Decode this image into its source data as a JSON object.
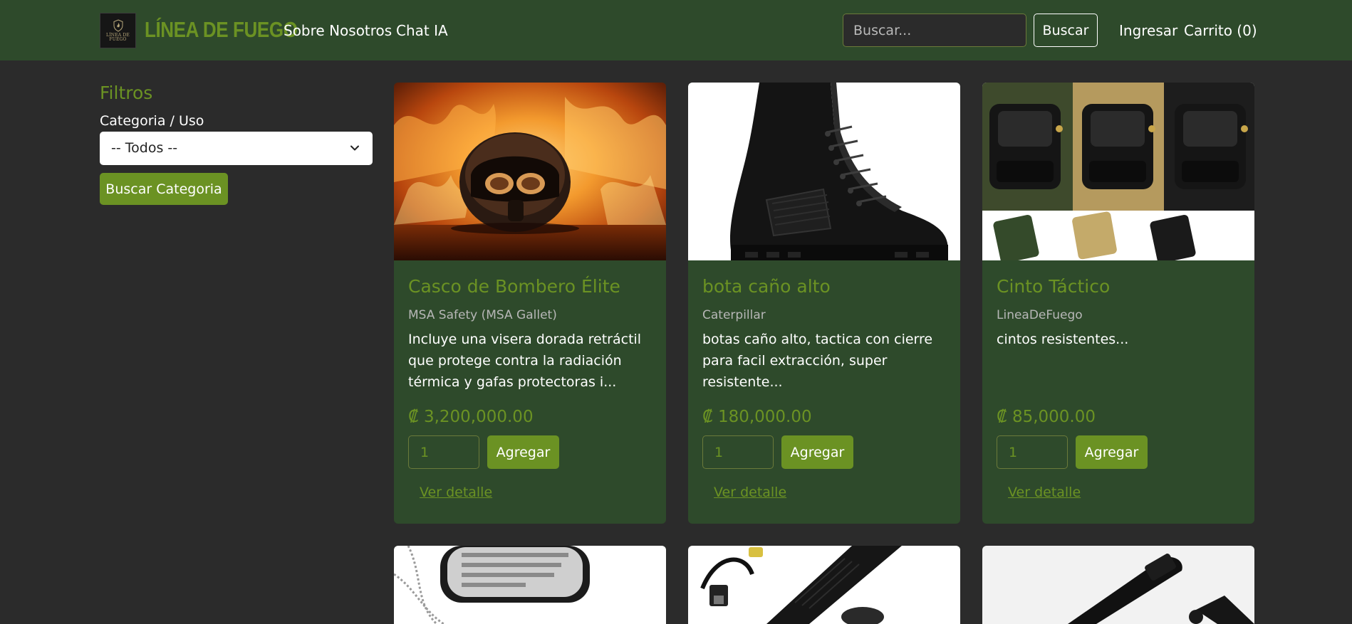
{
  "navbar": {
    "logo_text_line1": "LÍNEA DE",
    "logo_text_line2": "FUEGO",
    "brand": "LÍNEA DE FUEGO",
    "links": [
      {
        "label": "Sobre Nosotros"
      },
      {
        "label": "Chat IA"
      }
    ],
    "search_placeholder": "Buscar...",
    "search_button": "Buscar",
    "login": "Ingresar",
    "cart": "Carrito (0)"
  },
  "sidebar": {
    "title": "Filtros",
    "category_label": "Categoria / Uso",
    "category_selected": "-- Todos --",
    "category_button": "Buscar Categoria"
  },
  "products": [
    {
      "name": "Casco de Bombero Élite",
      "brand": "MSA Safety (MSA Gallet)",
      "description": "Incluye una visera dorada retráctil que protege contra la radiación térmica y gafas protectoras i...",
      "price": "₡ 3,200,000.00",
      "quantity": "1",
      "add_label": "Agregar",
      "detail_label": "Ver detalle",
      "image_icon": "firefighter-helmet-in-flames"
    },
    {
      "name": "bota caño alto",
      "brand": "Caterpillar",
      "description": "botas caño alto, tactica con cierre para facil extracción, super resistente...",
      "price": "₡ 180,000.00",
      "quantity": "1",
      "add_label": "Agregar",
      "detail_label": "Ver detalle",
      "image_icon": "black-tactical-boot"
    },
    {
      "name": "Cinto Táctico",
      "brand": "LineaDeFuego",
      "description": "cintos resistentes...",
      "price": "₡ 85,000.00",
      "quantity": "1",
      "add_label": "Agregar",
      "detail_label": "Ver detalle",
      "image_icon": "tactical-belts"
    },
    {
      "image_icon": "dog-tags"
    },
    {
      "image_icon": "flashlight"
    },
    {
      "image_icon": "baton"
    }
  ],
  "colors": {
    "navbar_bg": "#2e4a2b",
    "page_bg": "#2b2b2b",
    "accent": "#6b9223",
    "card_bg": "#2e4a2b"
  }
}
